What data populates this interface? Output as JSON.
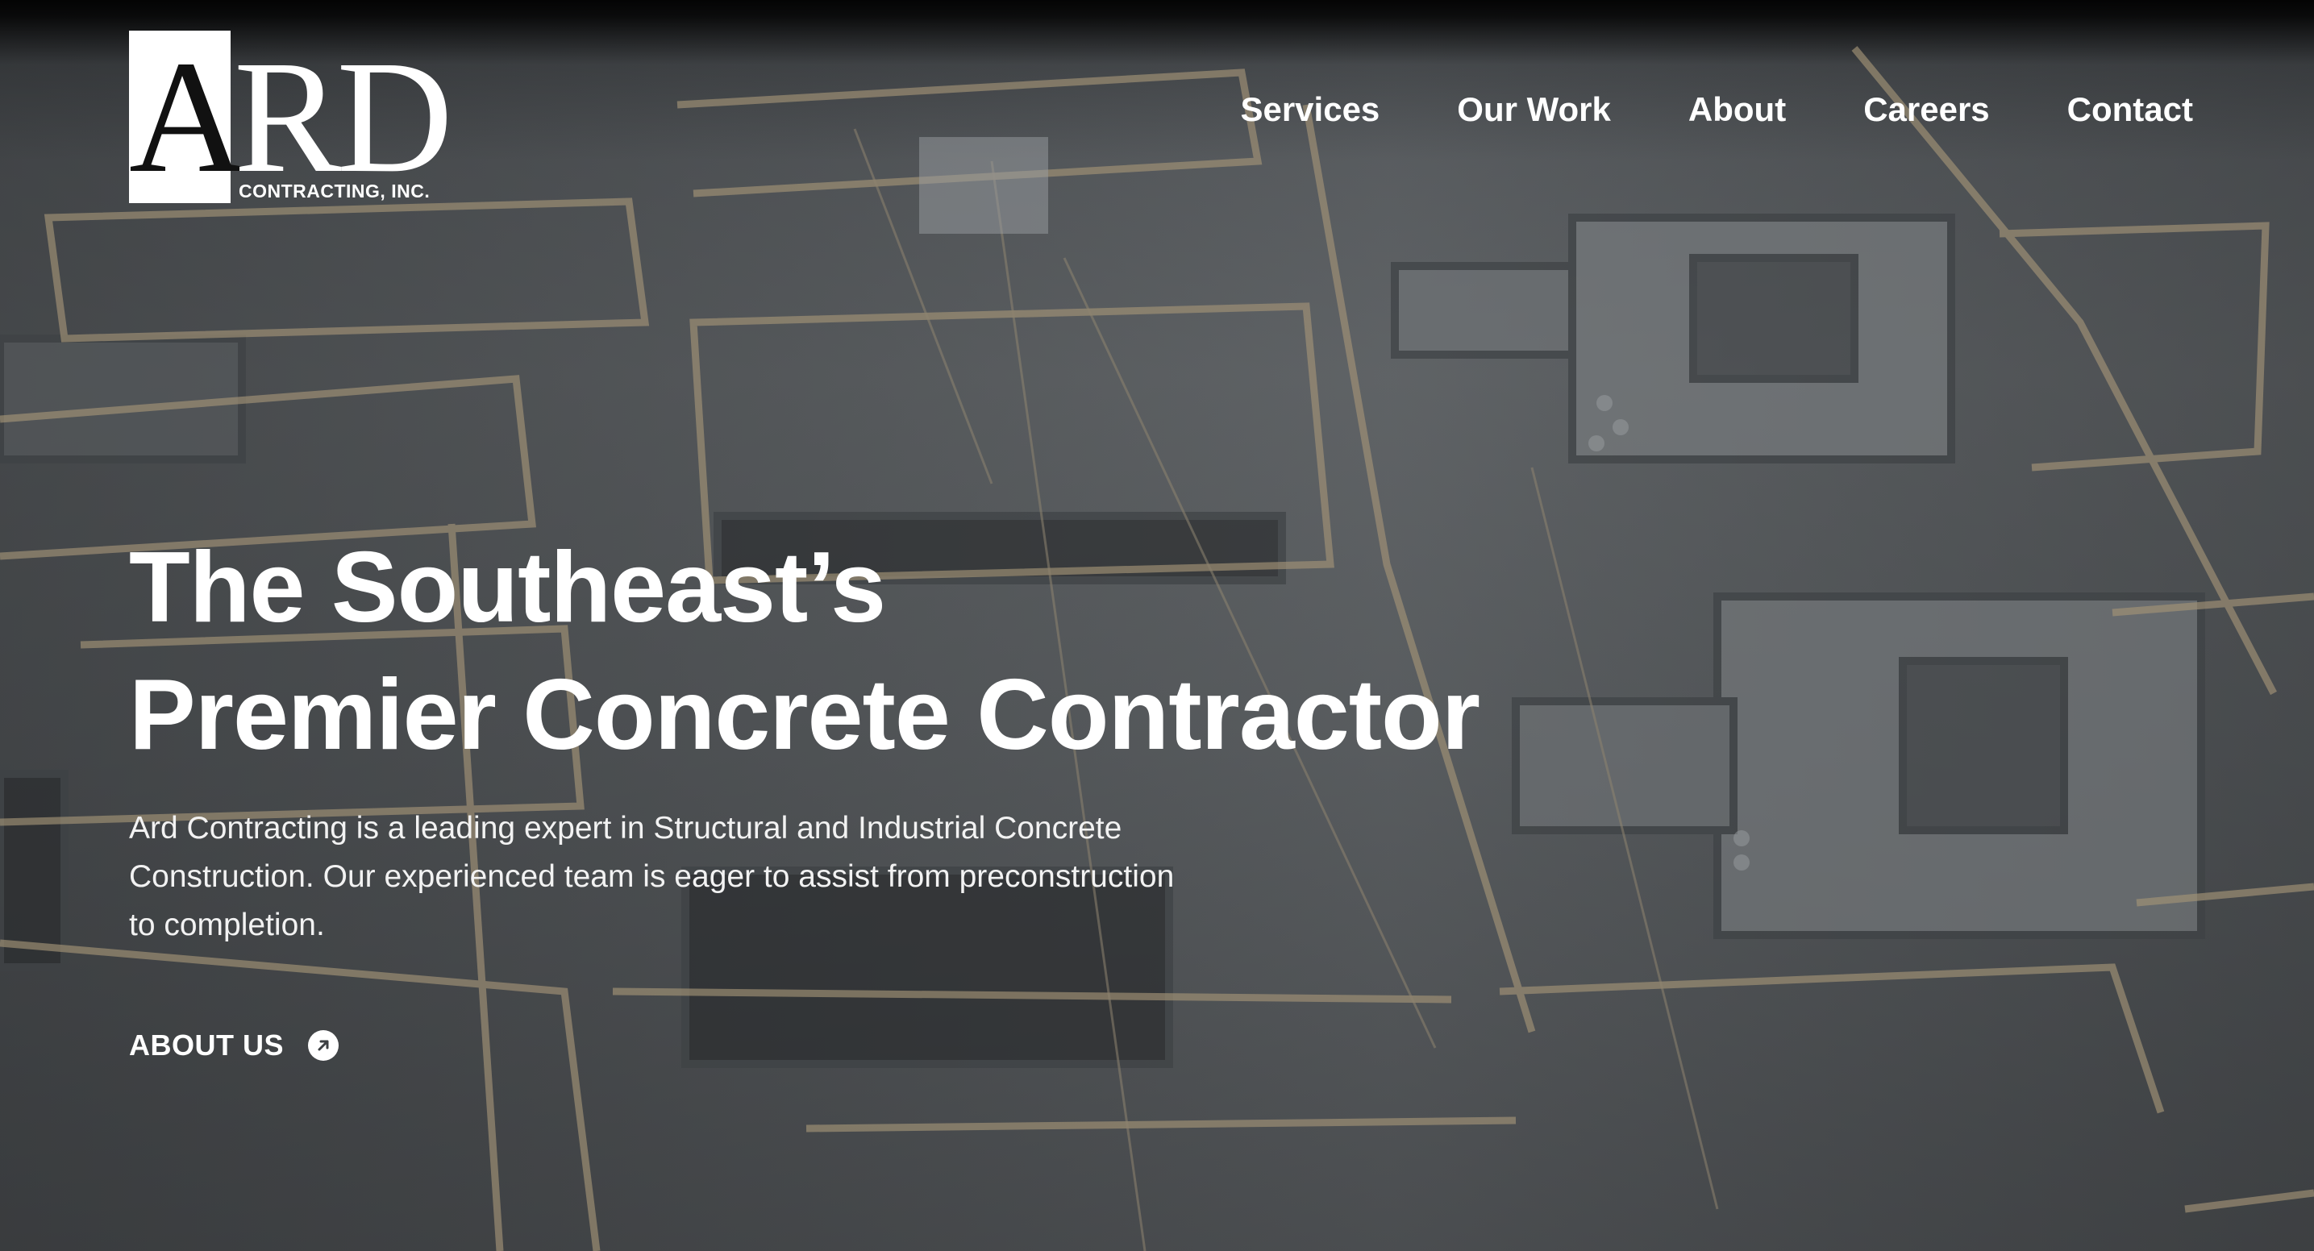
{
  "brand": {
    "logo_letter": "A",
    "logo_rest": "RD",
    "logo_subtitle": "CONTRACTING, INC."
  },
  "nav": {
    "items": [
      {
        "label": "Services"
      },
      {
        "label": "Our Work"
      },
      {
        "label": "About"
      },
      {
        "label": "Careers"
      },
      {
        "label": "Contact"
      }
    ]
  },
  "hero": {
    "headline_line1": "The Southeast’s",
    "headline_line2": "Premier Concrete Contractor",
    "intro": "Ard Contracting is a leading expert in Structural and Industrial Concrete Construction. Our experienced team is eager to assist from preconstruction to completion.",
    "cta_label": "ABOUT US",
    "cta_icon": "arrow-up-right-circle-icon",
    "background": "aerial photo of concrete building under construction with wooden scaffolding"
  },
  "colors": {
    "text": "#ffffff",
    "overlay": "#3d4043"
  }
}
